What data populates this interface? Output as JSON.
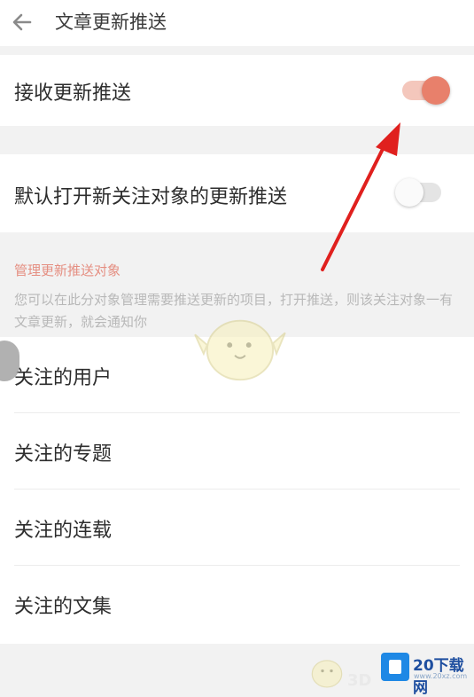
{
  "header": {
    "title": "文章更新推送",
    "back_icon": "back-arrow-icon"
  },
  "push_toggle": {
    "label": "接收更新推送",
    "state": "on"
  },
  "default_toggle": {
    "label": "默认打开新关注对象的更新推送",
    "state": "off"
  },
  "manage_section": {
    "title": "管理更新推送对象",
    "description": "您可以在此分对象管理需要推送更新的项目，打开推送，则该关注对象一有文章更新，就会通知你"
  },
  "list": [
    {
      "label": "关注的用户"
    },
    {
      "label": "关注的专题"
    },
    {
      "label": "关注的连载"
    },
    {
      "label": "关注的文集"
    }
  ],
  "watermark": {
    "brand": "20下载网",
    "site": "www.20xz.com",
    "small": "3D"
  },
  "colors": {
    "accent": "#e8806b",
    "arrow": "#e0201e",
    "section_title": "#e58f82"
  }
}
